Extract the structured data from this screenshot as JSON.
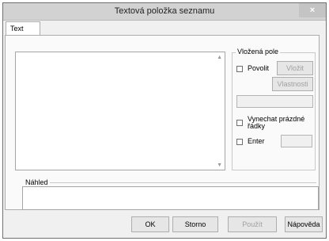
{
  "window": {
    "title": "Textová položka seznamu",
    "close_label": "×"
  },
  "tabs": [
    {
      "label": "Text"
    }
  ],
  "scrollbar": {
    "up_arrow": "▲",
    "down_arrow": "▼"
  },
  "inserted_field": {
    "legend": "Vložená pole",
    "enable_label": "Povolit",
    "insert_button": "Vložit",
    "properties_button": "Vlastnosti",
    "skip_empty_label": "Vynechat prázdné řádky",
    "enter_label": "Enter"
  },
  "preview": {
    "label": "Náhled"
  },
  "footer": {
    "ok": "OK",
    "cancel": "Storno",
    "apply": "Použít",
    "help": "Nápověda"
  }
}
